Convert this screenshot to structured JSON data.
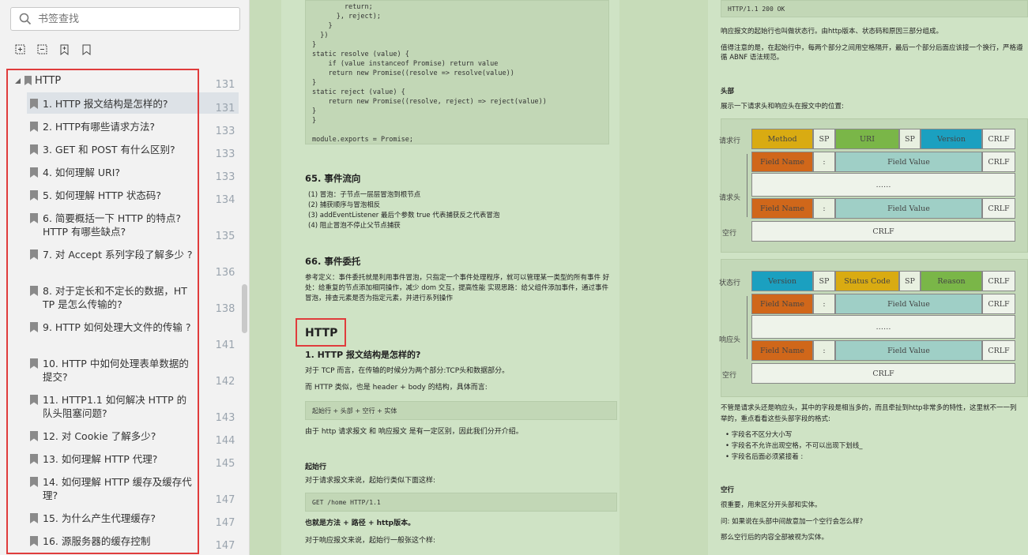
{
  "sidebar": {
    "search_placeholder": "书签查找",
    "root_title": "HTTP",
    "root_page": "131",
    "items": [
      {
        "title": "1. HTTP 报文结构是怎样的?",
        "page": "131"
      },
      {
        "title": "2. HTTP有哪些请求方法?",
        "page": "133"
      },
      {
        "title": "3. GET 和 POST 有什么区别?",
        "page": "133"
      },
      {
        "title": "4. 如何理解 URI?",
        "page": "133"
      },
      {
        "title": "5. 如何理解 HTTP 状态码?",
        "page": "134"
      },
      {
        "title": "6. 简要概括一下 HTTP 的特点? HTTP 有哪些缺点?",
        "page": "135"
      },
      {
        "title": "7. 对 Accept 系列字段了解多少 ?",
        "page": "136"
      },
      {
        "title": "8. 对于定长和不定长的数据，HT TP 是怎么传输的?",
        "page": "138"
      },
      {
        "title": "9. HTTP 如何处理大文件的传输 ?",
        "page": "141"
      },
      {
        "title": "10. HTTP 中如何处理表单数据的提交?",
        "page": "142"
      },
      {
        "title": "11. HTTP1.1 如何解决 HTTP 的队头阻塞问题?",
        "page": "143"
      },
      {
        "title": "12.  对 Cookie 了解多少?",
        "page": "144"
      },
      {
        "title": "13. 如何理解 HTTP 代理?",
        "page": "145"
      },
      {
        "title": "14. 如何理解 HTTP 缓存及缓存代理?",
        "page": "147"
      },
      {
        "title": "15. 为什么产生代理缓存?",
        "page": "147"
      },
      {
        "title": "16. 源服务器的缓存控制",
        "page": "147"
      }
    ]
  },
  "doc": {
    "code1": [
      "        return;",
      "      }, reject);",
      "    }",
      "  })",
      "}",
      "static resolve (value) {",
      "    if (value instanceof Promise) return value",
      "    return new Promise((resolve => resolve(value))",
      "}",
      "static reject (value) {",
      "    return new Promise((resolve, reject) => reject(value))",
      "}",
      "}",
      "",
      "module.exports = Promise;"
    ],
    "s65_title": "65. 事件流向",
    "s65_lines": [
      "(1)  冒泡：子节点一层层冒泡到根节点",
      "(2)  捕获顺序与冒泡相反",
      "(3)  addEventListener 最后个参数 true 代表捕获反之代表冒泡",
      "(4)  阻止冒泡不停止父节点捕获"
    ],
    "s66_title": "66. 事件委托",
    "s66_lines": [
      "参考定义：事件委托就是利用事件冒泡，只指定一个事件处理程序，就可以管理某一类型的所有事件 好",
      "处：给重复的节点添加相同操作，减少 dom 交互，提高性能 实现思路：给父组件添加事件，通过事件",
      "冒泡，排查元素是否为指定元素，并进行系列操作"
    ],
    "http_title": "HTTP",
    "q1_title": "1. HTTP 报文结构是怎样的?",
    "q1_p1": "对于 TCP 而言，在传输的时候分为两个部分:TCP头和数据部分。",
    "q1_p2": "而 HTTP 类似，也是 header + body 的结构，具体而言:",
    "q1_code": "起始行 + 头部 + 空行 + 实体",
    "q1_p3": "由于 http 请求报文 和 响应报文 是有一定区别，因此我们分开介绍。",
    "start_title": "起始行",
    "start_p1": "对于请求报文来说，起始行类似下面这样:",
    "start_code": "GET /home HTTP/1.1",
    "start_p2": "也就是方法 + 路径 + http版本。",
    "start_p3": "对于响应报文来说，起始行一般张这个样:",
    "p2_code": "HTTP/1.1 200 OK",
    "p2_l1": "响应报文的起始行也叫做状态行。由http版本、状态码和原因三部分组成。",
    "p2_l2": "值得注意的是，在起始行中，每两个部分之间用空格隔开，最后一个部分后面应该接一个换行，严格遵",
    "p2_l3": "循 ABNF 语法规范。",
    "head_title": "头部",
    "head_p1": "展示一下请求头和响应头在报文中的位置:",
    "req_labels": {
      "line": "请求行",
      "head": "请求头",
      "blank": "空行"
    },
    "req_row": [
      "Method",
      "SP",
      "URI",
      "SP",
      "Version",
      "CRLF"
    ],
    "field_name": "Field Name",
    "colon": ":",
    "field_value": "Field Value",
    "crlf": "CRLF",
    "dots": "……",
    "resp_labels": {
      "line": "状态行",
      "head": "响应头",
      "blank": "空行"
    },
    "resp_row": [
      "Version",
      "SP",
      "Status Code",
      "SP",
      "Reason",
      "CRLF"
    ],
    "p2_l4": "不管是请求头还是响应头，其中的字段是相当多的，而且牵扯到http非常多的特性，这里就不一一列",
    "p2_l5": "举的，重点看看这些头部字段的格式:",
    "bullets": [
      "字段名不区分大小写",
      "字段名不允许出现空格，不可以出现下划线_",
      "字段名后面必须紧接着 :"
    ],
    "blank_title": "空行",
    "blank_p1": "很重要，用来区分开头部和实体。",
    "blank_p2": "问: 如果说在头部中间故意加一个空行会怎么样?",
    "blank_p3": "那么空行后的内容全部被视为实体。"
  },
  "colors": {
    "method": "#d9ab12",
    "uri": "#7ab648",
    "version": "#1ba0c0",
    "field": "#d0671a",
    "value": "#9fcfc6",
    "sp": "#e8f0e0",
    "crlf": "#eef3ea"
  }
}
